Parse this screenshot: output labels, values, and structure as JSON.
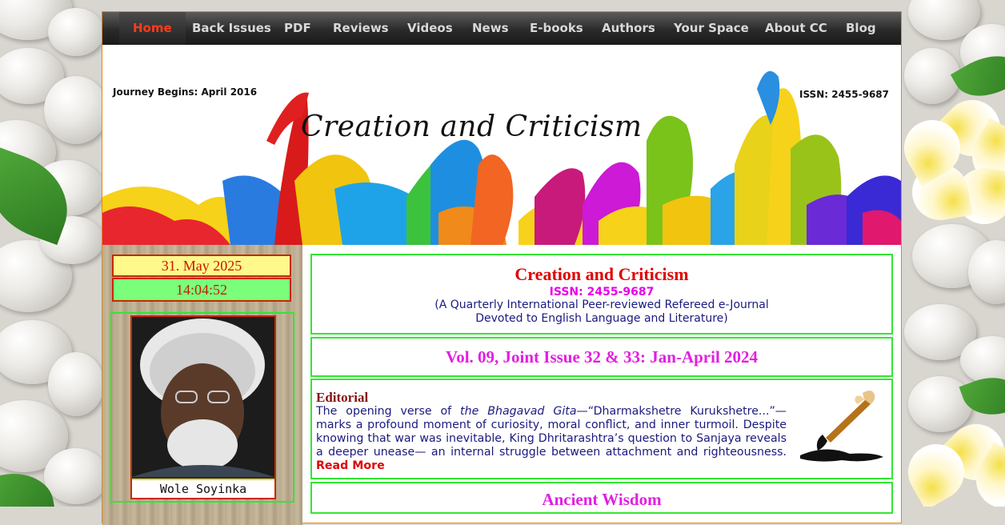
{
  "nav": {
    "items": [
      "Home",
      "Back Issues",
      "PDF",
      "Reviews",
      "Videos",
      "News",
      "E-books",
      "Authors",
      "Your Space",
      "About CC",
      "Blog"
    ]
  },
  "banner": {
    "journey": "Journey Begins: April 2016",
    "issn": "ISSN: 2455-9687",
    "title": "Creation and Criticism"
  },
  "sidebar": {
    "date": "31. May 2025",
    "time": "14:04:52",
    "portrait_caption": "Wole Soyinka"
  },
  "journal": {
    "title": "Creation and Criticism",
    "issn": "ISSN: 2455-9687",
    "desc_line1": "(A Quarterly International Peer-reviewed Refereed e-Journal",
    "desc_line2": "Devoted to English Language and Literature)"
  },
  "issue": {
    "label": "Vol. 09, Joint Issue 32 & 33: Jan-April 2024"
  },
  "editorial": {
    "title": "Editorial",
    "text_before": "The opening verse of ",
    "text_italic": "the Bhagavad Gita",
    "text_after": "—“Dharmakshetre Kurukshetre...”— marks a profound moment of curiosity, moral conflict, and inner turmoil. Despite knowing that war was inevitable, King Dhritarashtra’s question to Sanjaya reveals a deeper unease— an internal struggle between attachment and righteousness. ",
    "read_more": "Read More"
  },
  "section": {
    "ancient_wisdom": "Ancient Wisdom"
  },
  "colors": {
    "nav_active": "#ff3b1a",
    "box_border": "#33e633",
    "journal_title": "#e00000",
    "issue_magenta": "#e020e0"
  }
}
